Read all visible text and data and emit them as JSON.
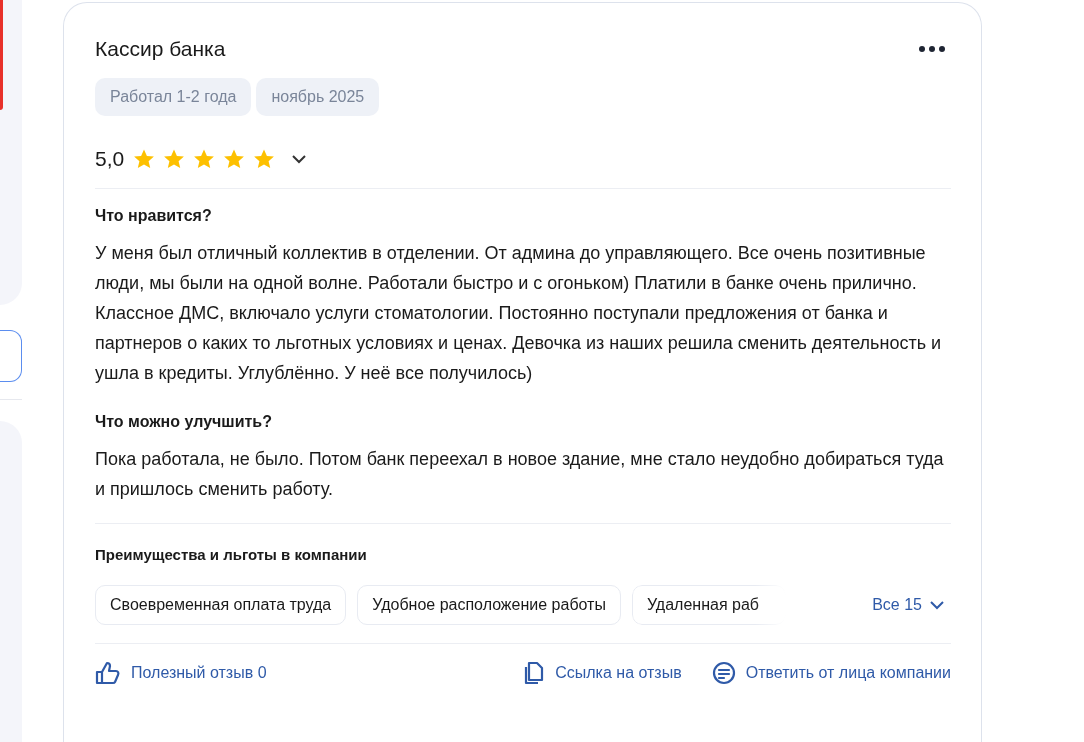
{
  "review": {
    "title": "Кассир банка",
    "tags": [
      "Работал 1-2 года",
      "ноябрь 2025"
    ],
    "rating": "5,0",
    "stars": 5,
    "sections": [
      {
        "heading": "Что нравится?",
        "text": "У меня был отличный коллектив в отделении. От админа до управляющего. Все очень позитивные люди, мы были на одной волне. Работали быстро и с огоньком) Платили в банке очень прилично. Классное ДМС, включало услуги стоматологии. Постоянно поступали предложения от банка и партнеров о каких то льготных условиях и ценах. Девочка из наших решила сменить деятельность и ушла в кредиты. Углублённо. У неё все получилось)"
      },
      {
        "heading": "Что можно улучшить?",
        "text": "Пока работала, не было. Потом банк переехал в новое здание, мне стало неудобно добираться туда и пришлось сменить работу."
      }
    ],
    "benefits": {
      "heading": "Преимущества и льготы в компании",
      "items": [
        "Своевременная оплата труда",
        "Удобное расположение работы",
        "Удаленная раб"
      ],
      "more": "Все 15"
    },
    "actions": [
      {
        "kind": "like",
        "label": "Полезный отзыв 0"
      },
      {
        "kind": "link",
        "label": "Ссылка на отзыв"
      },
      {
        "kind": "reply",
        "label": "Ответить от лица компании"
      }
    ]
  }
}
